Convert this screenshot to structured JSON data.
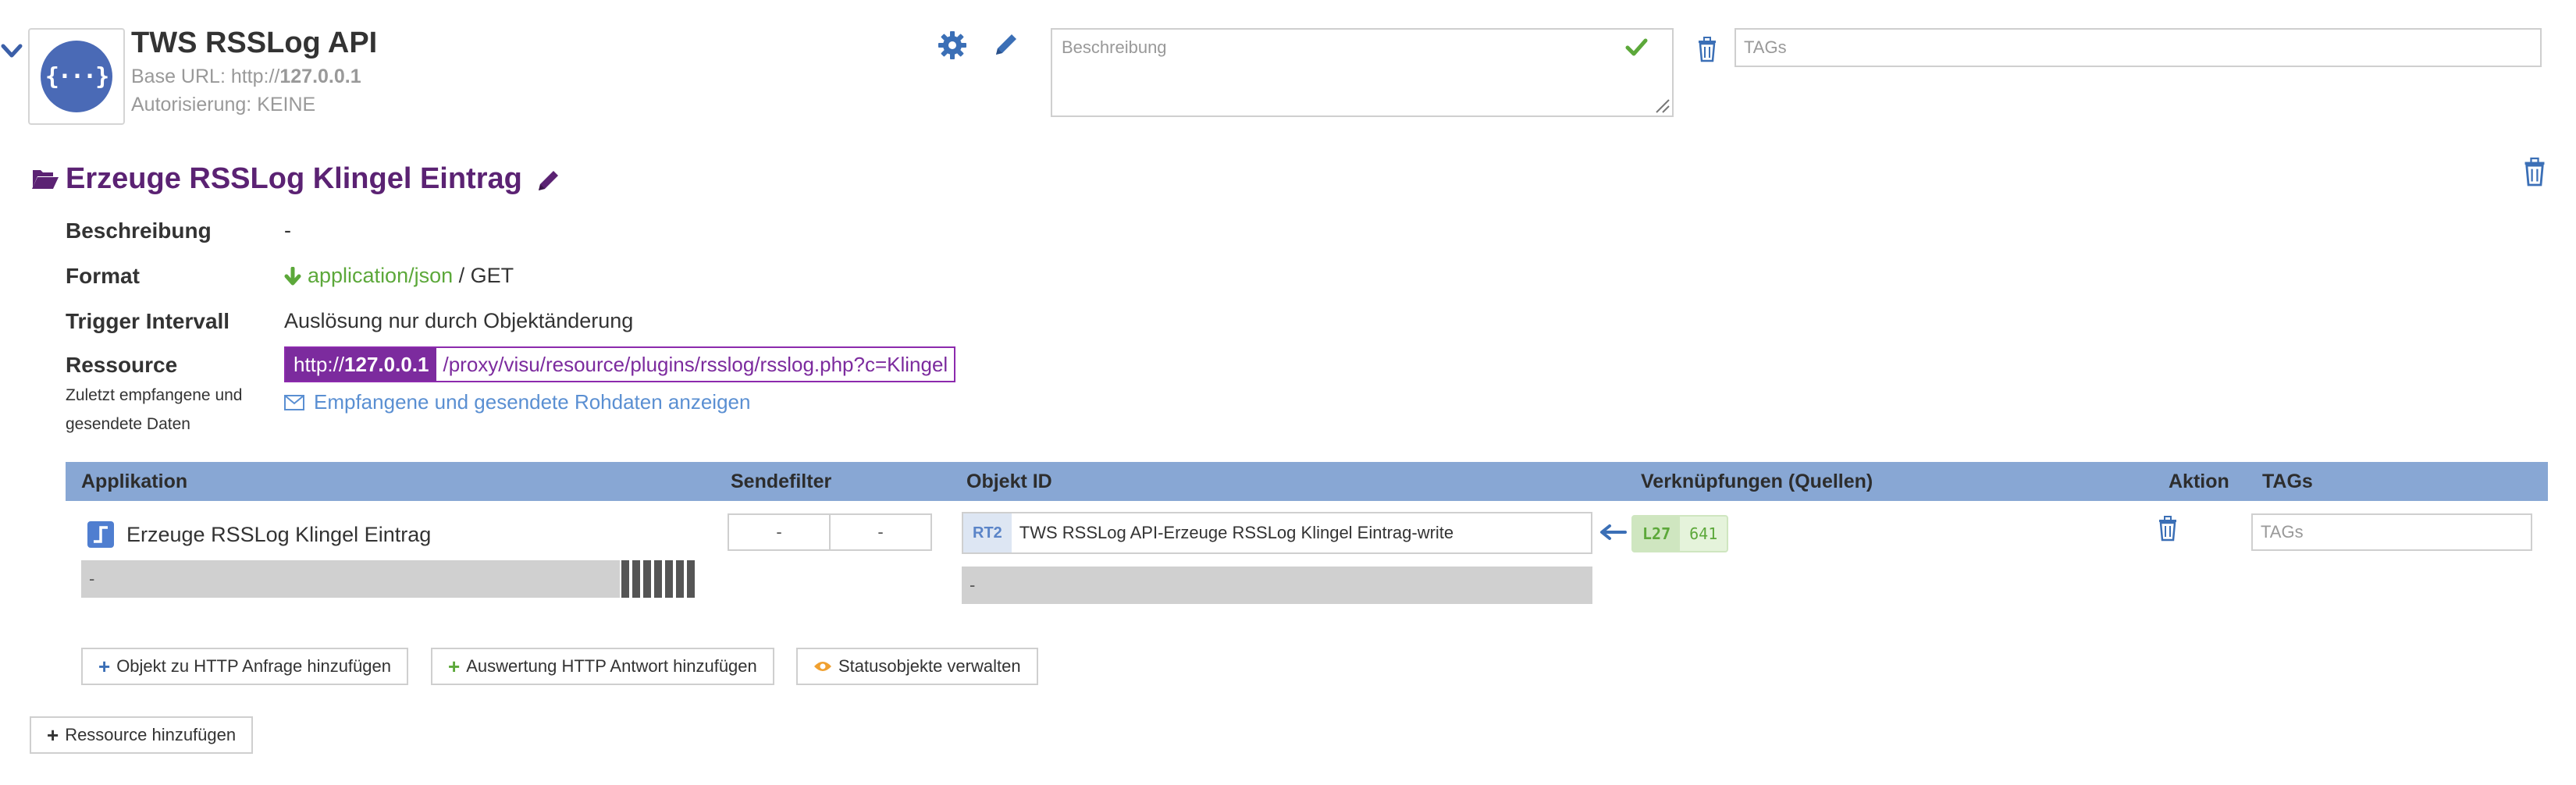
{
  "api": {
    "logo_glyph": "{···}",
    "title": "TWS RSSLog API",
    "base_url_label": "Base URL: http://",
    "base_url_host": "127.0.0.1",
    "auth_label": "Autorisierung: KEINE",
    "description_placeholder": "Beschreibung",
    "tags_placeholder": "TAGs"
  },
  "resource": {
    "title": "Erzeuge RSSLog Klingel Eintrag",
    "fields": {
      "beschreibung_label": "Beschreibung",
      "beschreibung_value": "-",
      "format_label": "Format",
      "format_type": "application/json",
      "format_method": " / GET",
      "trigger_label": "Trigger Intervall",
      "trigger_value": "Auslösung nur durch Objektänderung",
      "ressource_label": "Ressource",
      "last_data_label_1": "Zuletzt empfangene und",
      "last_data_label_2": "gesendete Daten"
    },
    "url_prefix": "http://",
    "url_host": "127.0.0.1",
    "url_path": "/proxy/visu/resource/plugins/rsslog/rsslog.php?c=Klingel",
    "raw_data_link": "Empfangene und gesendete Rohdaten anzeigen"
  },
  "table": {
    "headers": {
      "app": "Applikation",
      "send_filter": "Sendefilter",
      "object_id": "Objekt ID",
      "links": "Verknüpfungen (Quellen)",
      "action": "Aktion",
      "tags": "TAGs"
    },
    "rows": [
      {
        "app_name": "Erzeuge RSSLog Klingel Eintrag",
        "app_value": "-",
        "send_filter": [
          "-",
          "-"
        ],
        "object_type": "RT2",
        "object_name": "TWS RSSLog API-Erzeuge RSSLog Klingel Eintrag-write",
        "object_value": "-",
        "link_label": "L27",
        "link_id": "641",
        "tags_placeholder": "TAGs"
      }
    ]
  },
  "buttons": {
    "add_object": "Objekt zu HTTP Anfrage hinzufügen",
    "add_eval": "Auswertung HTTP Antwort hinzufügen",
    "status_objects": "Statusobjekte verwalten",
    "add_resource": "Ressource hinzufügen"
  },
  "colors": {
    "accent_blue": "#3b6fb6",
    "resource_purple": "#7c2b9e",
    "header_blue": "#88a7d4",
    "success_green": "#5ca83a",
    "status_orange": "#f0a030"
  }
}
